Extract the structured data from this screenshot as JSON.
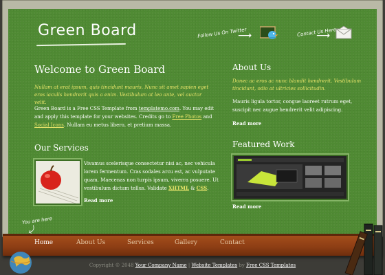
{
  "header": {
    "logo": "Green Board",
    "follow_text": "Follow Us On Twitter",
    "contact_text": "Contact Us Here"
  },
  "welcome": {
    "title": "Welcome to Green Board",
    "lead": "Nullam at erat ipsum, quis tincidunt mauris. Nunc sit amet sapien eget eros iaculis hendrerit quis a enim. Vestibulum at leo ante, vel auctor velit.",
    "body_1": "Green Board is a Free CSS Template from ",
    "link_1": "templatemo.com",
    "body_2": ". You may edit and apply this template for your websites. Credits go to ",
    "link_2": "Free Photos",
    "body_3": " and ",
    "link_3": "Social Icons",
    "body_4": ". Nullam eu metus libero, et pretium massa."
  },
  "services": {
    "title": "Our Services",
    "text_1": "Vivamus scelerisque consectetur nisi ac, nec vehicula lorem fermentum. Cras sodales arcu est, ac vulputate quam. Maecenas non turpis ipsum, viverra posuere. Ut vestibulum dictum tellus. Validate ",
    "link_xhtml": "XHTML",
    "amp": " & ",
    "link_css": "CSS",
    "period": ".",
    "read_more": "Read more"
  },
  "about": {
    "title": "About Us",
    "lead": "Donec ac eros ac nunc blandit hendrerit. Vestibulum tincidunt, odio at ultricies sollicitudin.",
    "body": "Mauris ligula tortor, congue laoreet rutrum eget, suscipit nec augue hendrerit velit adipiscing.",
    "read_more": "Read more"
  },
  "featured": {
    "title": "Featured Work",
    "read_more": "Read more"
  },
  "you_are_here": "You are here",
  "nav": [
    {
      "label": "Home",
      "active": true
    },
    {
      "label": "About Us",
      "active": false
    },
    {
      "label": "Services",
      "active": false
    },
    {
      "label": "Gallery",
      "active": false
    },
    {
      "label": "Contact",
      "active": false
    }
  ],
  "footer": {
    "copyright": "Copyright © 2048 ",
    "company": "Your Company Name",
    "sep": " | ",
    "website_templates": "Website Templates",
    "by": " by ",
    "free_css": "Free CSS Templates"
  },
  "colors": {
    "board": "#4f8a33",
    "accent_yellow": "#e8e46a",
    "ledge": "#8d3e14",
    "frame": "#b9b9a6"
  },
  "icons": [
    "twitter-bird-icon",
    "mail-envelope-icon",
    "globe-icon",
    "books-icon",
    "apple-icon",
    "arrow-icon"
  ]
}
